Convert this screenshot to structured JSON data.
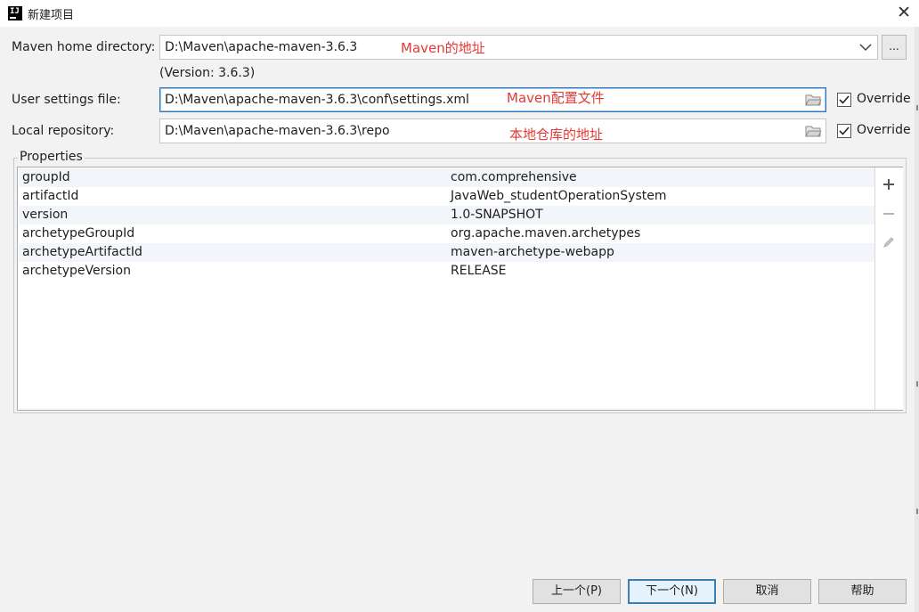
{
  "window": {
    "title": "新建项目",
    "close": "✕"
  },
  "maven_home": {
    "label": "Maven home directory:",
    "value": "D:\\Maven\\apache-maven-3.6.3",
    "annotation": "Maven的地址",
    "version": "(Version: 3.6.3)",
    "browse_label": "..."
  },
  "user_settings": {
    "label": "User settings file:",
    "value": "D:\\Maven\\apache-maven-3.6.3\\conf\\settings.xml",
    "annotation": "Maven配置文件",
    "override_label": "Override",
    "override_checked": true
  },
  "local_repo": {
    "label": "Local repository:",
    "value": "D:\\Maven\\apache-maven-3.6.3\\repo",
    "annotation": "本地仓库的地址",
    "override_label": "Override",
    "override_checked": true
  },
  "properties": {
    "title": "Properties",
    "rows": [
      {
        "key": "groupId",
        "value": "com.comprehensive"
      },
      {
        "key": "artifactId",
        "value": "JavaWeb_studentOperationSystem"
      },
      {
        "key": "version",
        "value": "1.0-SNAPSHOT"
      },
      {
        "key": "archetypeGroupId",
        "value": "org.apache.maven.archetypes"
      },
      {
        "key": "archetypeArtifactId",
        "value": "maven-archetype-webapp"
      },
      {
        "key": "archetypeVersion",
        "value": "RELEASE"
      }
    ],
    "tools": [
      "add-icon",
      "remove-icon",
      "edit-icon"
    ]
  },
  "footer": {
    "prev": "上一个(P)",
    "next": "下一个(N)",
    "cancel": "取消",
    "help": "帮助"
  },
  "colors": {
    "annotation": "#e53935",
    "focus_border": "#2f75b5",
    "primary_border": "#3c7fb1"
  }
}
